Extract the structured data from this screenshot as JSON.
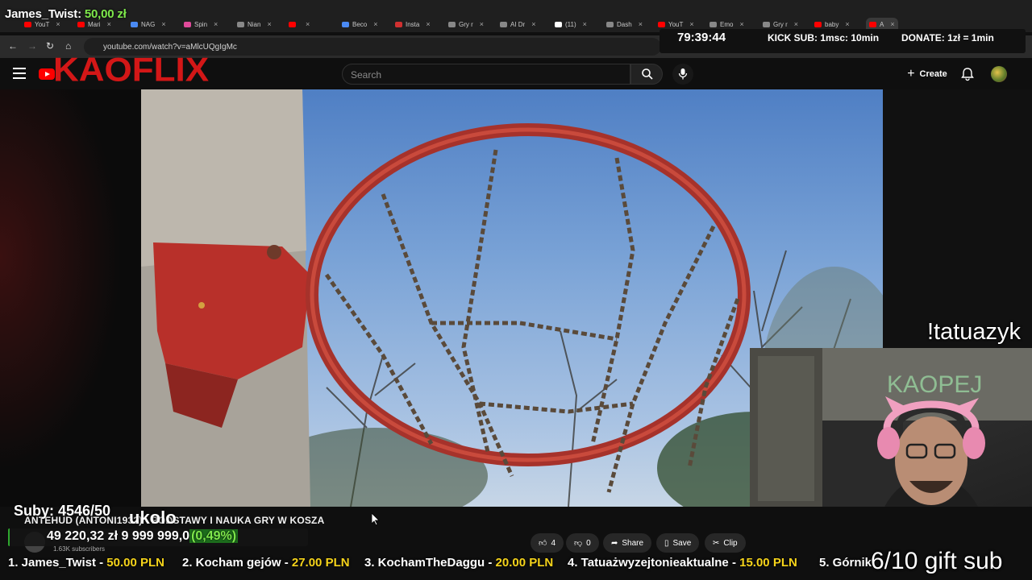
{
  "browser": {
    "tabs": [
      {
        "label": "YouT",
        "color": "#ff0000"
      },
      {
        "label": "Mari",
        "color": "#ff0000"
      },
      {
        "label": "NAG",
        "color": "#4a8af4"
      },
      {
        "label": "Spin",
        "color": "#e04a9a"
      },
      {
        "label": "Nian",
        "color": "#888888"
      },
      {
        "label": "",
        "color": "#ff0000"
      },
      {
        "label": "Beco",
        "color": "#4a8af4"
      },
      {
        "label": "Insta",
        "color": "#d03030"
      },
      {
        "label": "Gry r",
        "color": "#888888"
      },
      {
        "label": "AI Dr",
        "color": "#888888"
      },
      {
        "label": "(11)",
        "color": "#ffffff"
      },
      {
        "label": "Dash",
        "color": "#888888"
      },
      {
        "label": "YouT",
        "color": "#ff0000"
      },
      {
        "label": "Emo",
        "color": "#888888"
      },
      {
        "label": "Gry r",
        "color": "#888888"
      },
      {
        "label": "baby",
        "color": "#ff0000"
      },
      {
        "label": "A",
        "color": "#ff0000"
      }
    ],
    "url": "youtube.com/watch?v=aMlcUQgIgMc"
  },
  "overlay": {
    "donor_name": "James_Twist:",
    "donor_amount": "50,00 zł",
    "timer": "79:39:44",
    "kick_sub": "KICK SUB: 1msc: 10min",
    "donate_rate": "DONATE: 1zł = 1min",
    "tatuazyk": "!tatuazyk",
    "subs": "Suby: 4546/50",
    "kolo": "ukolo",
    "goal_amount": "49 220,32 zł",
    "goal_target": "9 999 999,0",
    "goal_pct": "(0,49%)",
    "goal_fraction": 0.0049,
    "gift_sub": "6/10 gift sub",
    "ticker": [
      {
        "name": "1. James_Twist - ",
        "amount": "50.00 PLN"
      },
      {
        "name": "2. Kocham gejów - ",
        "amount": "27.00 PLN"
      },
      {
        "name": "3. KochamTheDaggu - ",
        "amount": "20.00 PLN"
      },
      {
        "name": "4. Tatuażwyzejtonieaktualne - ",
        "amount": "15.00 PLN"
      },
      {
        "name": "5. Górnik",
        "amount": ""
      }
    ]
  },
  "youtube": {
    "brand_overlay": "KAOFLIX",
    "search_placeholder": "Search",
    "create_label": "Create",
    "video_title": "ANTEHUD (ANTONI1932) - PODSTAWY I NAUKA GRY W KOSZA",
    "channel_subs": "1.63K subscribers",
    "likes": "4",
    "dislikes": "0",
    "share_label": "Share",
    "save_label": "Save",
    "clip_label": "Clip"
  },
  "colors": {
    "accent_red": "#d31717",
    "goal_green": "#7ee84b",
    "ticker_amount": "#f5d31a"
  }
}
